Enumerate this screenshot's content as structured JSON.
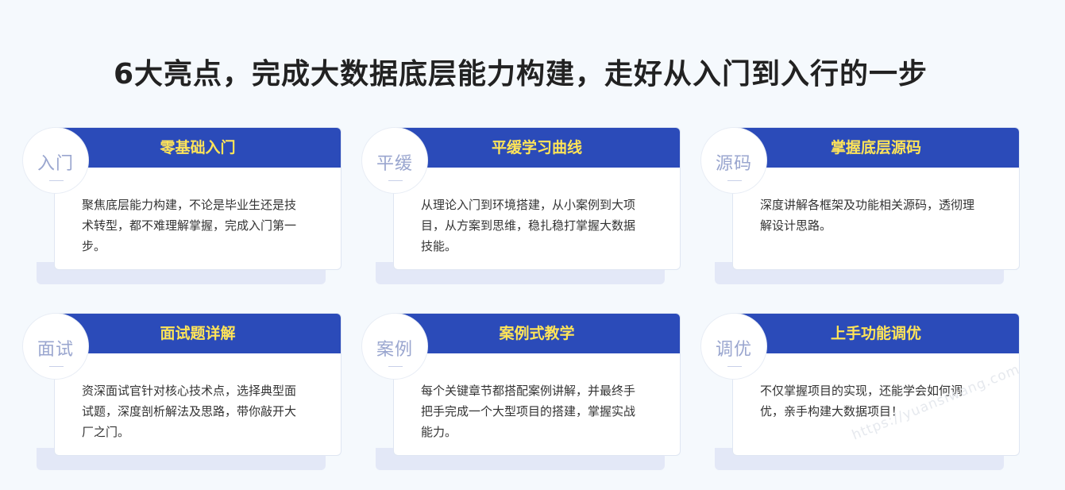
{
  "title": "6大亮点，完成大数据底层能力构建，走好从入门到入行的一步",
  "cards": [
    {
      "badge": "入门",
      "heading": "零基础入门",
      "body": "聚焦底层能力构建，不论是毕业生还是技术转型，都不难理解掌握，完成入门第一步。"
    },
    {
      "badge": "平缓",
      "heading": "平缓学习曲线",
      "body": "从理论入门到环境搭建，从小案例到大项目，从方案到思维，稳扎稳打掌握大数据技能。"
    },
    {
      "badge": "源码",
      "heading": "掌握底层源码",
      "body": "深度讲解各框架及功能相关源码，透彻理解设计思路。"
    },
    {
      "badge": "面试",
      "heading": "面试题详解",
      "body": "资深面试官针对核心技术点，选择典型面试题，深度剖析解法及思路，带你敲开大厂之门。"
    },
    {
      "badge": "案例",
      "heading": "案例式教学",
      "body": "每个关键章节都搭配案例讲解，并最终手把手完成一个大型项目的搭建，掌握实战能力。"
    },
    {
      "badge": "调优",
      "heading": "上手功能调优",
      "body": "不仅掌握项目的实现，还能学会如何调优，亲手构建大数据项目！"
    }
  ],
  "watermark": "https://yuansiwang.com",
  "colors": {
    "header_bg": "#2b4bb9",
    "header_text": "#ffe458",
    "badge_text": "#9aa6cf"
  }
}
